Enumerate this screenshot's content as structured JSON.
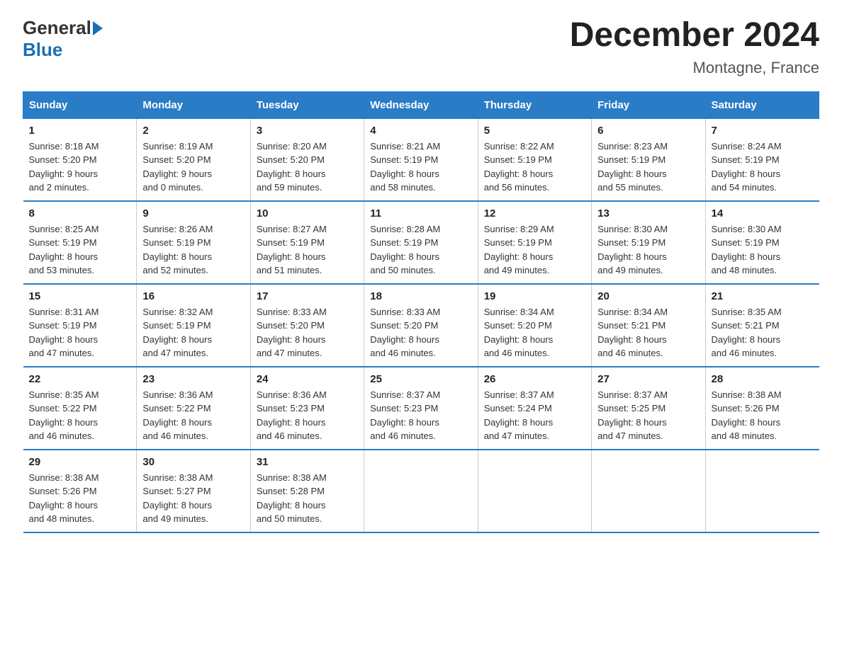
{
  "header": {
    "logo_general": "General",
    "logo_blue": "Blue",
    "title": "December 2024",
    "subtitle": "Montagne, France"
  },
  "weekdays": [
    "Sunday",
    "Monday",
    "Tuesday",
    "Wednesday",
    "Thursday",
    "Friday",
    "Saturday"
  ],
  "weeks": [
    [
      {
        "day": "1",
        "info": "Sunrise: 8:18 AM\nSunset: 5:20 PM\nDaylight: 9 hours\nand 2 minutes."
      },
      {
        "day": "2",
        "info": "Sunrise: 8:19 AM\nSunset: 5:20 PM\nDaylight: 9 hours\nand 0 minutes."
      },
      {
        "day": "3",
        "info": "Sunrise: 8:20 AM\nSunset: 5:20 PM\nDaylight: 8 hours\nand 59 minutes."
      },
      {
        "day": "4",
        "info": "Sunrise: 8:21 AM\nSunset: 5:19 PM\nDaylight: 8 hours\nand 58 minutes."
      },
      {
        "day": "5",
        "info": "Sunrise: 8:22 AM\nSunset: 5:19 PM\nDaylight: 8 hours\nand 56 minutes."
      },
      {
        "day": "6",
        "info": "Sunrise: 8:23 AM\nSunset: 5:19 PM\nDaylight: 8 hours\nand 55 minutes."
      },
      {
        "day": "7",
        "info": "Sunrise: 8:24 AM\nSunset: 5:19 PM\nDaylight: 8 hours\nand 54 minutes."
      }
    ],
    [
      {
        "day": "8",
        "info": "Sunrise: 8:25 AM\nSunset: 5:19 PM\nDaylight: 8 hours\nand 53 minutes."
      },
      {
        "day": "9",
        "info": "Sunrise: 8:26 AM\nSunset: 5:19 PM\nDaylight: 8 hours\nand 52 minutes."
      },
      {
        "day": "10",
        "info": "Sunrise: 8:27 AM\nSunset: 5:19 PM\nDaylight: 8 hours\nand 51 minutes."
      },
      {
        "day": "11",
        "info": "Sunrise: 8:28 AM\nSunset: 5:19 PM\nDaylight: 8 hours\nand 50 minutes."
      },
      {
        "day": "12",
        "info": "Sunrise: 8:29 AM\nSunset: 5:19 PM\nDaylight: 8 hours\nand 49 minutes."
      },
      {
        "day": "13",
        "info": "Sunrise: 8:30 AM\nSunset: 5:19 PM\nDaylight: 8 hours\nand 49 minutes."
      },
      {
        "day": "14",
        "info": "Sunrise: 8:30 AM\nSunset: 5:19 PM\nDaylight: 8 hours\nand 48 minutes."
      }
    ],
    [
      {
        "day": "15",
        "info": "Sunrise: 8:31 AM\nSunset: 5:19 PM\nDaylight: 8 hours\nand 47 minutes."
      },
      {
        "day": "16",
        "info": "Sunrise: 8:32 AM\nSunset: 5:19 PM\nDaylight: 8 hours\nand 47 minutes."
      },
      {
        "day": "17",
        "info": "Sunrise: 8:33 AM\nSunset: 5:20 PM\nDaylight: 8 hours\nand 47 minutes."
      },
      {
        "day": "18",
        "info": "Sunrise: 8:33 AM\nSunset: 5:20 PM\nDaylight: 8 hours\nand 46 minutes."
      },
      {
        "day": "19",
        "info": "Sunrise: 8:34 AM\nSunset: 5:20 PM\nDaylight: 8 hours\nand 46 minutes."
      },
      {
        "day": "20",
        "info": "Sunrise: 8:34 AM\nSunset: 5:21 PM\nDaylight: 8 hours\nand 46 minutes."
      },
      {
        "day": "21",
        "info": "Sunrise: 8:35 AM\nSunset: 5:21 PM\nDaylight: 8 hours\nand 46 minutes."
      }
    ],
    [
      {
        "day": "22",
        "info": "Sunrise: 8:35 AM\nSunset: 5:22 PM\nDaylight: 8 hours\nand 46 minutes."
      },
      {
        "day": "23",
        "info": "Sunrise: 8:36 AM\nSunset: 5:22 PM\nDaylight: 8 hours\nand 46 minutes."
      },
      {
        "day": "24",
        "info": "Sunrise: 8:36 AM\nSunset: 5:23 PM\nDaylight: 8 hours\nand 46 minutes."
      },
      {
        "day": "25",
        "info": "Sunrise: 8:37 AM\nSunset: 5:23 PM\nDaylight: 8 hours\nand 46 minutes."
      },
      {
        "day": "26",
        "info": "Sunrise: 8:37 AM\nSunset: 5:24 PM\nDaylight: 8 hours\nand 47 minutes."
      },
      {
        "day": "27",
        "info": "Sunrise: 8:37 AM\nSunset: 5:25 PM\nDaylight: 8 hours\nand 47 minutes."
      },
      {
        "day": "28",
        "info": "Sunrise: 8:38 AM\nSunset: 5:26 PM\nDaylight: 8 hours\nand 48 minutes."
      }
    ],
    [
      {
        "day": "29",
        "info": "Sunrise: 8:38 AM\nSunset: 5:26 PM\nDaylight: 8 hours\nand 48 minutes."
      },
      {
        "day": "30",
        "info": "Sunrise: 8:38 AM\nSunset: 5:27 PM\nDaylight: 8 hours\nand 49 minutes."
      },
      {
        "day": "31",
        "info": "Sunrise: 8:38 AM\nSunset: 5:28 PM\nDaylight: 8 hours\nand 50 minutes."
      },
      {
        "day": "",
        "info": ""
      },
      {
        "day": "",
        "info": ""
      },
      {
        "day": "",
        "info": ""
      },
      {
        "day": "",
        "info": ""
      }
    ]
  ]
}
